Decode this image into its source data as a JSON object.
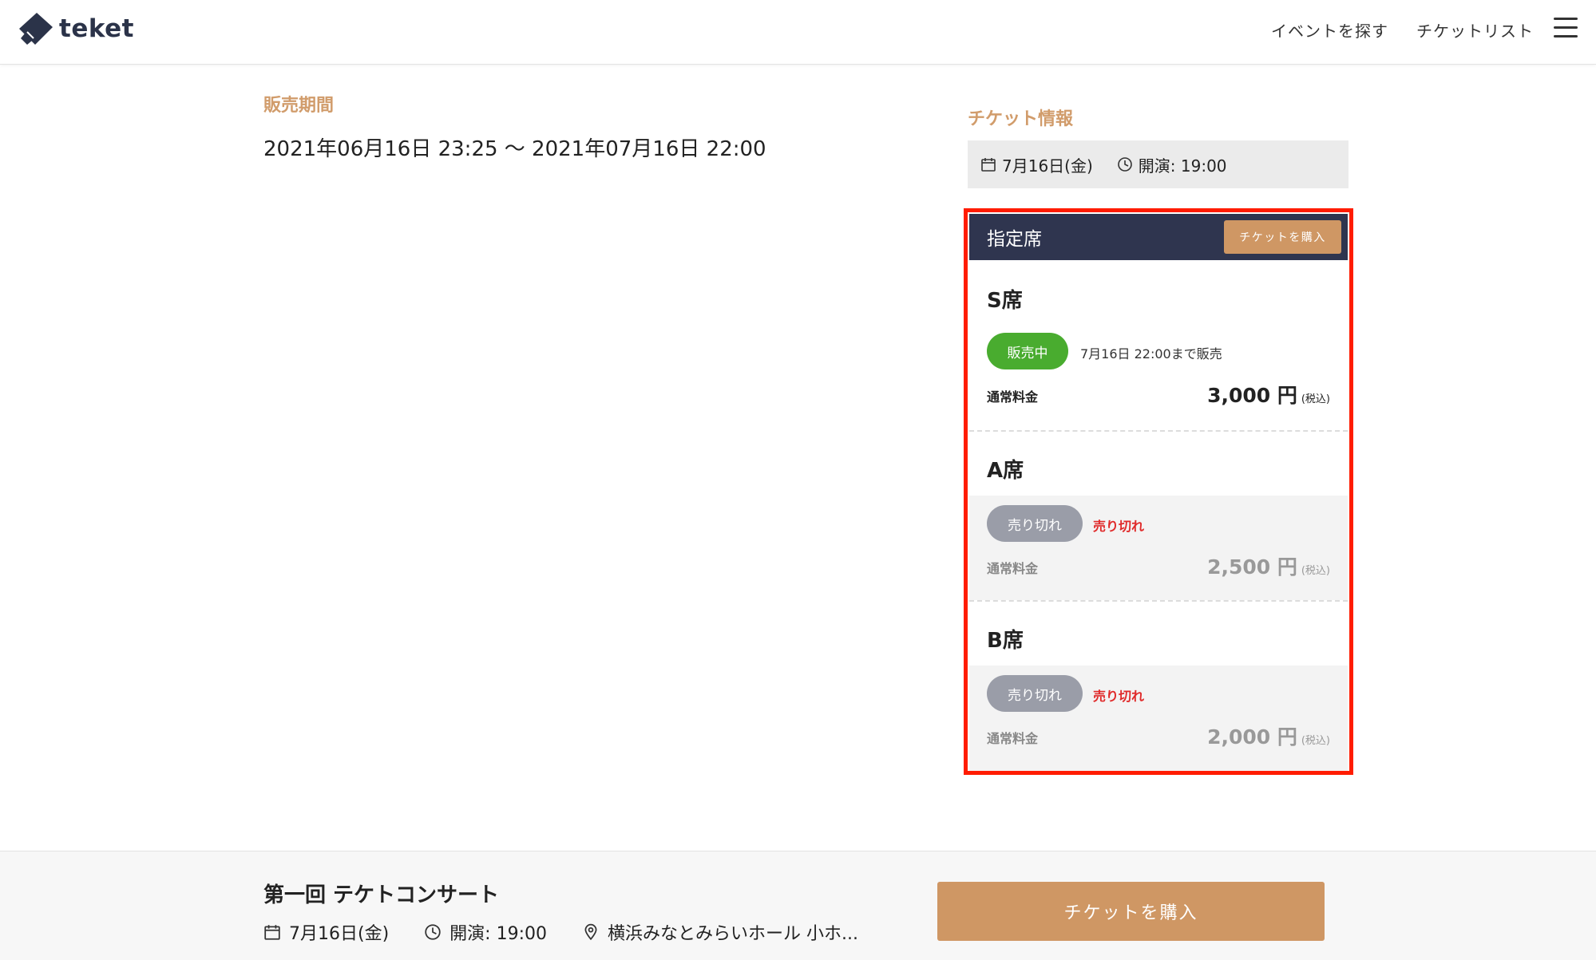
{
  "header": {
    "brand": "teket",
    "nav": {
      "events": "イベントを探す",
      "tickets": "チケットリスト"
    }
  },
  "sales_period": {
    "label": "販売期間",
    "value": "2021年06月16日 23:25 〜 2021年07月16日 22:00"
  },
  "ticket_info": {
    "title": "チケット情報",
    "date": "7月16日(金)",
    "start_time": "開演: 19:00"
  },
  "ticket_card": {
    "title": "指定席",
    "buy_label": "チケットを購入",
    "seats": [
      {
        "name": "S席",
        "status": "販売中",
        "note": "7月16日 22:00まで販売",
        "price_label": "通常料金",
        "price": "3,000 円",
        "tax": "(税込)"
      },
      {
        "name": "A席",
        "status": "売り切れ",
        "note": "売り切れ",
        "price_label": "通常料金",
        "price": "2,500 円",
        "tax": "(税込)"
      },
      {
        "name": "B席",
        "status": "売り切れ",
        "note": "売り切れ",
        "price_label": "通常料金",
        "price": "2,000 円",
        "tax": "(税込)"
      }
    ]
  },
  "footer": {
    "event_title": "第一回 テケトコンサート",
    "date": "7月16日(金)",
    "start_time": "開演: 19:00",
    "venue": "横浜みなとみらいホール 小ホ...",
    "buy_label": "チケットを購入"
  },
  "colors": {
    "accent": "#cf9764",
    "section_label": "#d19c6b",
    "card_header": "#2f354f",
    "on_sale": "#49ac2f",
    "sold_out_pill": "#9a9da8",
    "sold_out_text": "#e02a2a",
    "highlight_border": "#ff1c00"
  },
  "icons": [
    "teket-logo-icon",
    "menu-icon",
    "calendar-icon",
    "clock-icon",
    "location-pin-icon"
  ]
}
